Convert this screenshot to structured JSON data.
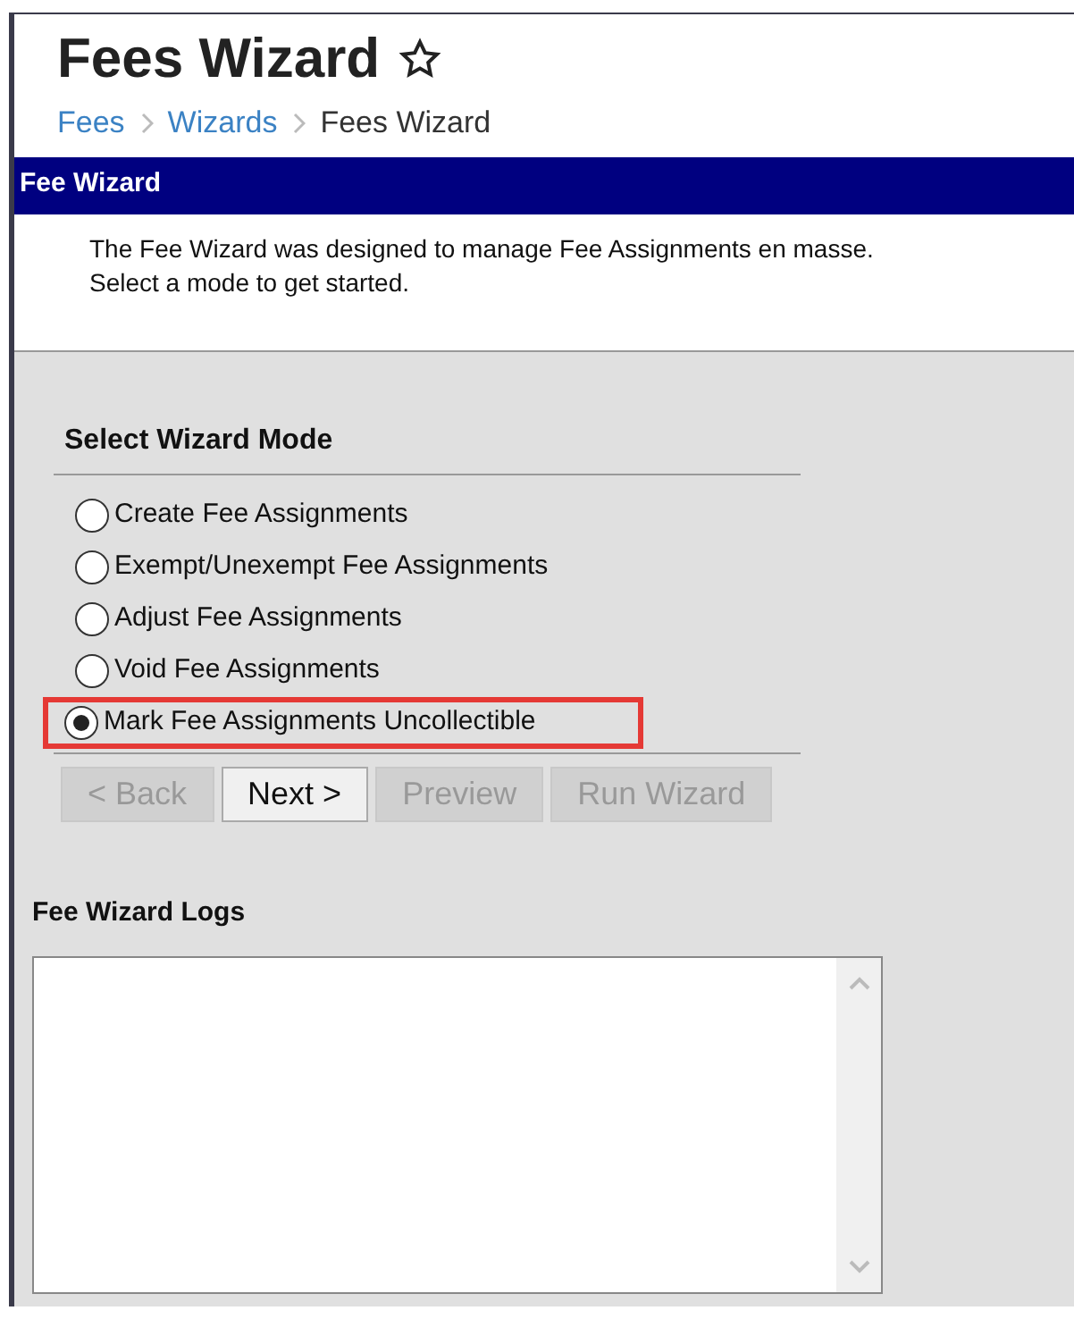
{
  "page": {
    "title": "Fees Wizard",
    "favorite": false
  },
  "breadcrumbs": [
    {
      "label": "Fees",
      "link": true
    },
    {
      "label": "Wizards",
      "link": true
    },
    {
      "label": "Fees Wizard",
      "link": false
    }
  ],
  "panel": {
    "title": "Fee Wizard",
    "description": "The Fee Wizard was designed to manage Fee Assignments en masse.\nSelect a mode to get started."
  },
  "mode_section": {
    "title": "Select Wizard Mode"
  },
  "modes": [
    {
      "label": "Create Fee Assignments",
      "selected": false,
      "highlighted": false
    },
    {
      "label": "Exempt/Unexempt Fee Assignments",
      "selected": false,
      "highlighted": false
    },
    {
      "label": "Adjust Fee Assignments",
      "selected": false,
      "highlighted": false
    },
    {
      "label": "Void Fee Assignments",
      "selected": false,
      "highlighted": false
    },
    {
      "label": "Mark Fee Assignments Uncollectible",
      "selected": true,
      "highlighted": true
    }
  ],
  "buttons": [
    {
      "label": "< Back",
      "disabled": true
    },
    {
      "label": "Next >",
      "disabled": false
    },
    {
      "label": "Preview",
      "disabled": true
    },
    {
      "label": "Run Wizard",
      "disabled": true
    }
  ],
  "logs": {
    "title": "Fee Wizard Logs"
  }
}
